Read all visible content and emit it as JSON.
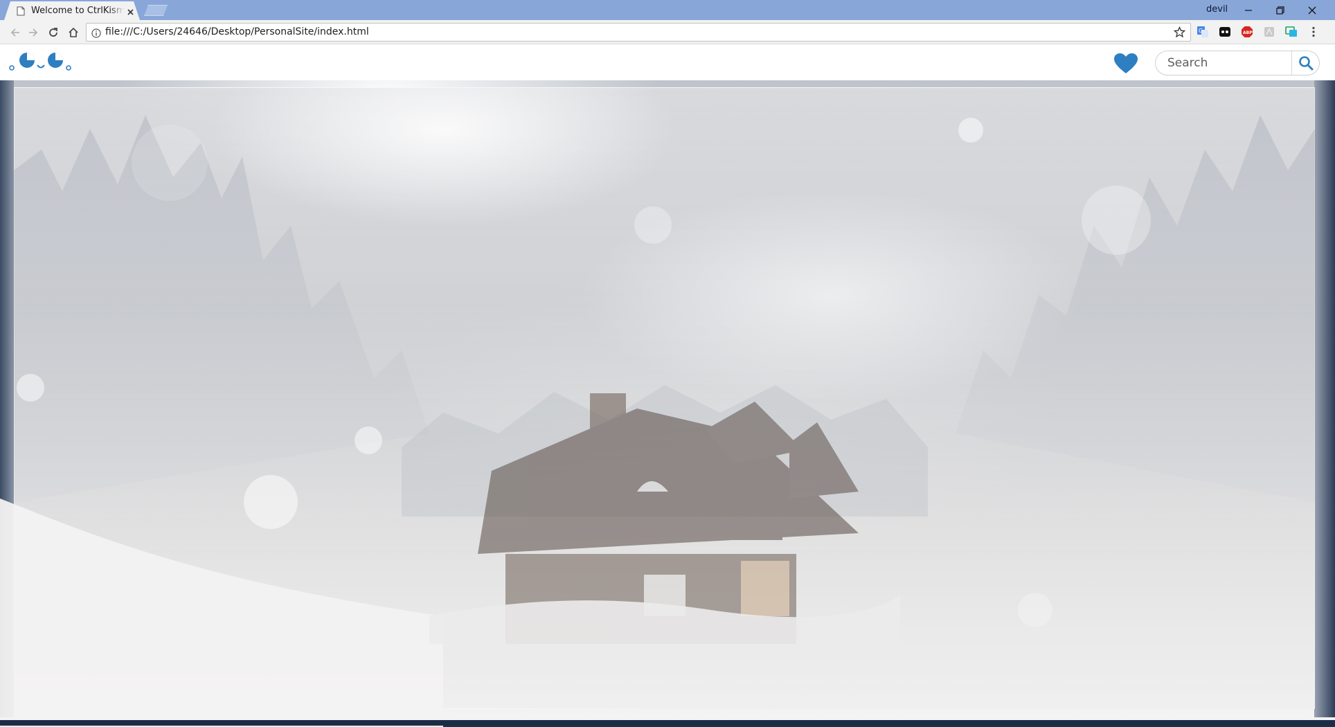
{
  "browser": {
    "tab": {
      "title": "Welcome to CtrlKismet"
    },
    "profile_name": "devil",
    "address": {
      "url": "file:///C:/Users/24646/Desktop/PersonalSite/index.html"
    },
    "icons": [
      "page-icon",
      "close-icon",
      "back-icon",
      "forward-icon",
      "reload-icon",
      "home-icon",
      "info-icon",
      "star-icon",
      "translate-icon",
      "ghostery-icon",
      "adblock-icon",
      "extension-icon",
      "cast-icon",
      "menu-icon",
      "minimize-icon",
      "restore-icon"
    ]
  },
  "site": {
    "logo_name": "logo-icon",
    "search": {
      "placeholder": "Search"
    },
    "accent_color": "#2d7fc1"
  },
  "hero": {
    "description_icon": "hero-image"
  }
}
